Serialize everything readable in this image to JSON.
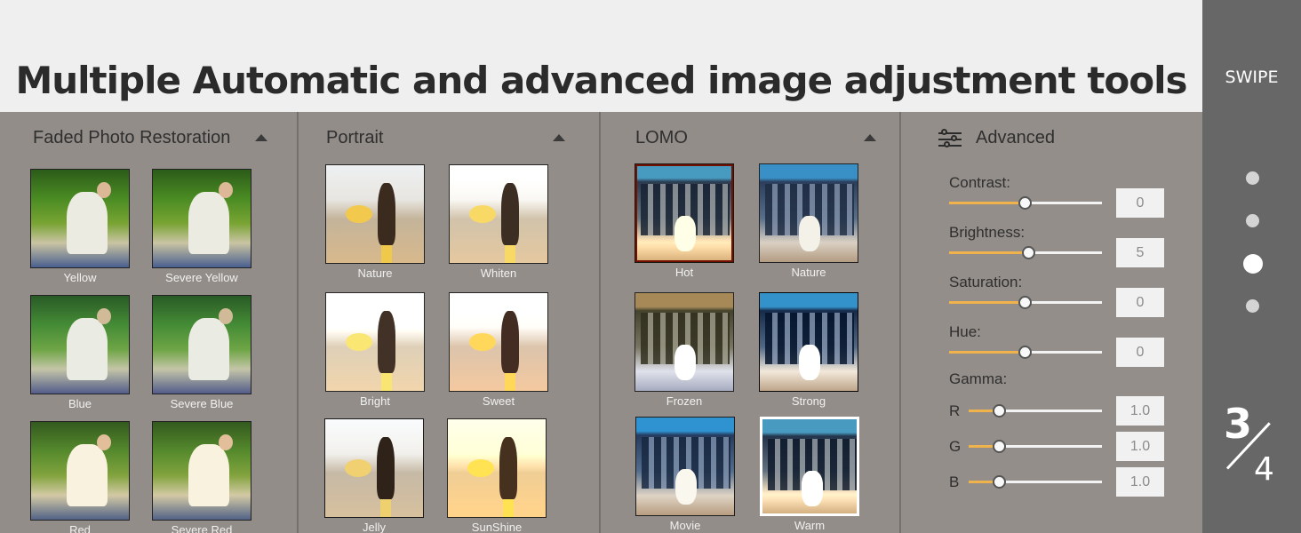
{
  "banner": {
    "title": "Multiple Automatic and advanced image adjustment tools"
  },
  "side": {
    "swipe_label": "SWIPE",
    "page_current": "3",
    "page_total": "4"
  },
  "panels": {
    "faded": {
      "title": "Faded Photo Restoration",
      "items": [
        "Yellow",
        "Severe Yellow",
        "Blue",
        "Severe Blue",
        "Red",
        "Severe Red"
      ]
    },
    "portrait": {
      "title": "Portrait",
      "items": [
        "Nature",
        "Whiten",
        "Bright",
        "Sweet",
        "Jelly",
        "SunShine"
      ]
    },
    "lomo": {
      "title": "LOMO",
      "items": [
        "Hot",
        "Nature",
        "Frozen",
        "Strong",
        "Movie",
        "Warm"
      ]
    },
    "advanced": {
      "title": "Advanced",
      "contrast_label": "Contrast:",
      "contrast_value": "0",
      "brightness_label": "Brightness:",
      "brightness_value": "5",
      "saturation_label": "Saturation:",
      "saturation_value": "0",
      "hue_label": "Hue:",
      "hue_value": "0",
      "gamma_label": "Gamma:",
      "r_label": "R",
      "r_value": "1.0",
      "g_label": "G",
      "g_value": "1.0",
      "b_label": "B",
      "b_value": "1.0"
    }
  },
  "colors": {
    "accent": "#f0b24a",
    "panel": "#928d89",
    "side": "#676767"
  }
}
